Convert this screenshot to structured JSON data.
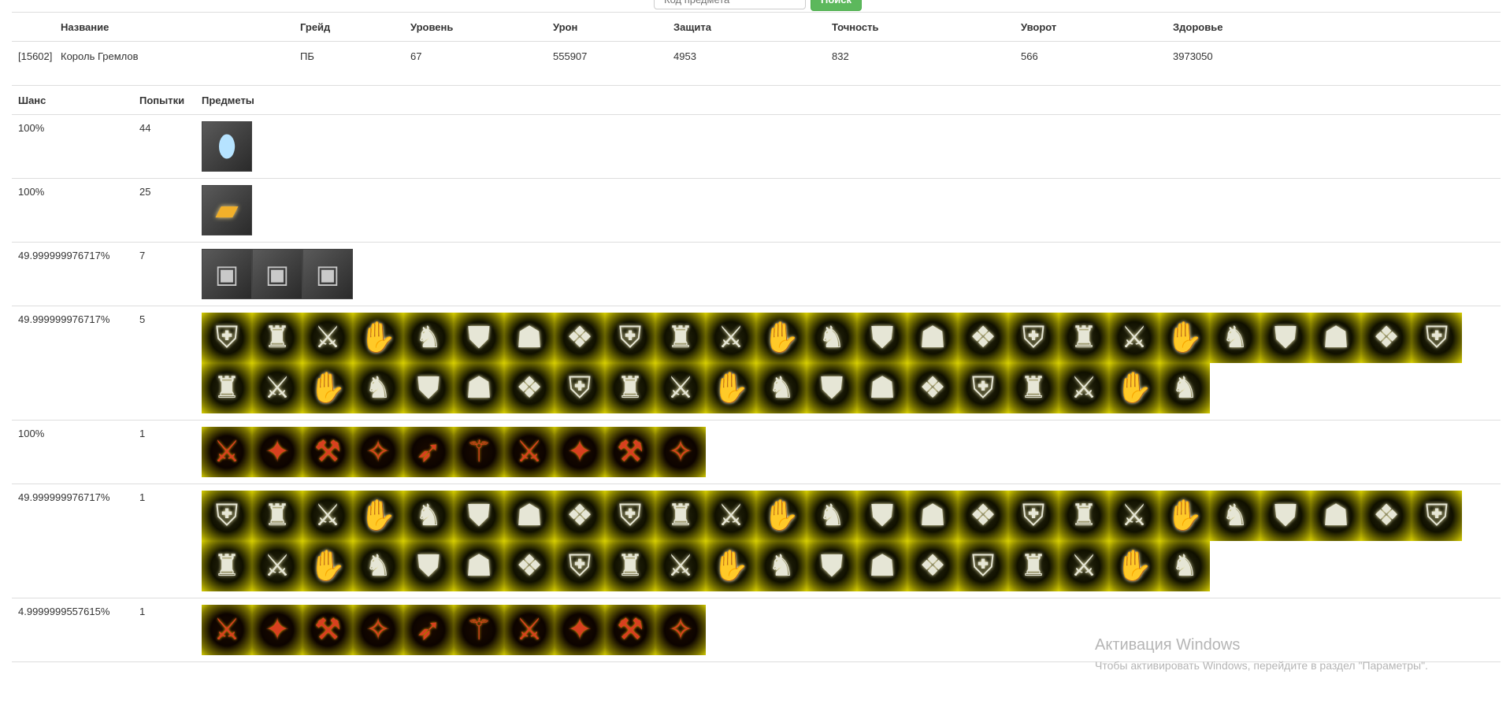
{
  "search": {
    "placeholder": "Код предмета",
    "button_label": "Поиск"
  },
  "mob_table": {
    "headers": [
      "Название",
      "Грейд",
      "Уровень",
      "Урон",
      "Защита",
      "Точность",
      "Уворот",
      "Здоровье"
    ],
    "row": {
      "id": "[15602]",
      "name": "Король Гремлов",
      "grade": "ПБ",
      "level": "67",
      "damage": "555907",
      "defense": "4953",
      "accuracy": "832",
      "evasion": "566",
      "health": "3973050"
    }
  },
  "drop_table": {
    "headers": [
      "Шанс",
      "Попытки",
      "Предметы"
    ],
    "rows": [
      {
        "chance": "100%",
        "tries": "44"
      },
      {
        "chance": "100%",
        "tries": "25"
      },
      {
        "chance": "49.999999976717%",
        "tries": "7"
      },
      {
        "chance": "49.999999976717%",
        "tries": "5"
      },
      {
        "chance": "100%",
        "tries": "1"
      },
      {
        "chance": "49.999999976717%",
        "tries": "1"
      },
      {
        "chance": "4.9999999557615%",
        "tries": "1"
      }
    ]
  },
  "watermark": {
    "title": "Активация Windows",
    "subtitle": "Чтобы активировать Windows, перейдите в раздел \"Параметры\"."
  }
}
